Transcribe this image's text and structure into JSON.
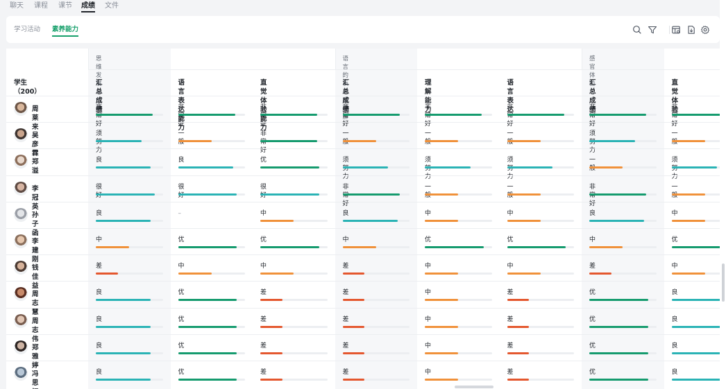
{
  "top_tabs": [
    "聊天",
    "课程",
    "课节",
    "成绩",
    "文件"
  ],
  "top_tab_active": 3,
  "sub_tabs": [
    "学习活动",
    "素养能力"
  ],
  "sub_tab_active": 1,
  "toolbar_icons": [
    "search-icon",
    "filter-icon",
    "table-settings-icon",
    "export-icon",
    "gear-icon"
  ],
  "colors": {
    "accent": "#17a06b",
    "excellent": "#159b6e",
    "good": "#2ab3b5",
    "medium": "#f0913a",
    "poor": "#e4572e",
    "track": "#eceef1"
  },
  "groups": [
    "思维发展与创新",
    "语言的表达和理解",
    "感官体验"
  ],
  "student_header": "学生（200）",
  "columns": [
    "汇总成绩",
    "语言表达能力",
    "直觉体验能力",
    "汇总成绩",
    "理解能力",
    "语言表达",
    "汇总成绩",
    "直觉体验"
  ],
  "levels": {
    "非常好": {
      "color": "excellent",
      "fill": 0.85
    },
    "很好": {
      "color": "good",
      "fill": 0.88
    },
    "优": {
      "color": "excellent",
      "fill": 0.88
    },
    "良": {
      "color": "good",
      "fill": 0.82
    },
    "中": {
      "color": "medium",
      "fill": 0.5
    },
    "一般": {
      "color": "medium",
      "fill": 0.5
    },
    "须努力": {
      "color": "good",
      "fill": 0.68
    },
    "差": {
      "color": "poor",
      "fill": 0.33
    },
    "–": {
      "color": "none",
      "fill": 0
    }
  },
  "students": [
    {
      "name": "周莱来",
      "grades": [
        "非常好",
        "非常好",
        "非常好",
        "非常好",
        "非常好",
        "非常好",
        "非常好",
        "非常好"
      ]
    },
    {
      "name": "吴彦霖",
      "grades": [
        "须努力",
        "一般",
        "非常好",
        "一般",
        "一般",
        "一般",
        "须努力",
        "一般"
      ]
    },
    {
      "name": "郑溢",
      "grades": [
        "良",
        "良",
        "优",
        "须努力",
        "须努力",
        "须努力",
        "一般",
        "须努力"
      ]
    },
    {
      "name": "李冠英",
      "grades": [
        "很好",
        "很好",
        "很好",
        "非常好",
        "一般",
        "一般",
        "非常好",
        "一般"
      ]
    },
    {
      "name": "孙子函",
      "grades": [
        "良",
        "–",
        "中",
        "良",
        "中",
        "中",
        "良",
        "中"
      ]
    },
    {
      "name": "李建刚",
      "grades": [
        "中",
        "优",
        "优",
        "中",
        "优",
        "优",
        "中",
        "优"
      ]
    },
    {
      "name": "钱佳益",
      "grades": [
        "差",
        "中",
        "中",
        "差",
        "中",
        "中",
        "差",
        "中"
      ]
    },
    {
      "name": "周志慧",
      "grades": [
        "良",
        "优",
        "差",
        "差",
        "中",
        "差",
        "优",
        "良"
      ]
    },
    {
      "name": "周志伟",
      "grades": [
        "良",
        "优",
        "差",
        "差",
        "中",
        "差",
        "优",
        "良"
      ]
    },
    {
      "name": "郑雅婷",
      "grades": [
        "良",
        "优",
        "差",
        "差",
        "中",
        "差",
        "优",
        "良"
      ]
    },
    {
      "name": "冯思钗",
      "grades": [
        "良",
        "优",
        "差",
        "差",
        "中",
        "差",
        "优",
        "良"
      ]
    }
  ]
}
